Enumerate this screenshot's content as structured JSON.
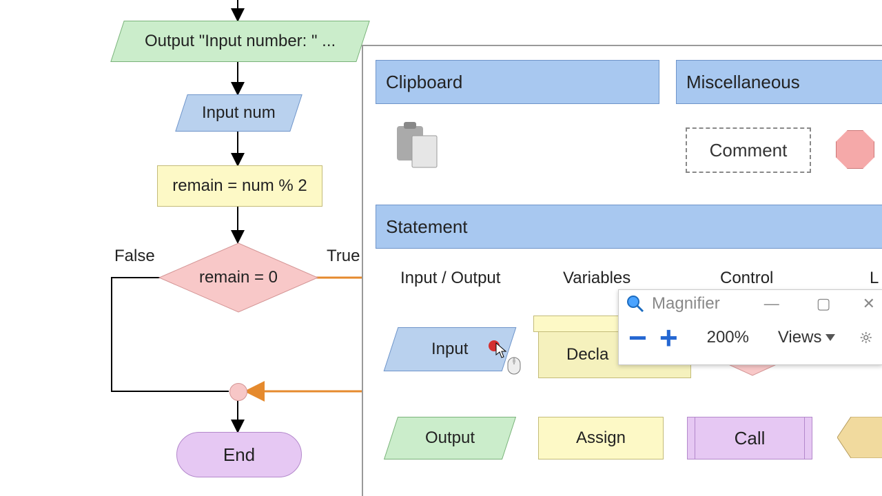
{
  "flowchart": {
    "output_prompt": "Output \"Input number: \" ...",
    "input_box": "Input num",
    "assign_box": "remain = num % 2",
    "decision_box": "remain = 0",
    "end_box": "End",
    "false_label": "False",
    "true_label": "True"
  },
  "panel": {
    "clipboard_header": "Clipboard",
    "misc_header": "Miscellaneous",
    "comment_label": "Comment",
    "statement_header": "Statement",
    "cat_io": "Input / Output",
    "cat_vars": "Variables",
    "cat_ctrl": "Control",
    "cat_loops_partial": "L",
    "shape_input": "Input",
    "shape_output": "Output",
    "shape_declare": "Decla",
    "shape_assign": "Assign",
    "shape_call": "Call"
  },
  "magnifier": {
    "title": "Magnifier",
    "zoom": "200%",
    "views": "Views",
    "minus": "−",
    "plus": "+",
    "min_btn": "—",
    "max_btn": "▢",
    "close_btn": "✕"
  }
}
